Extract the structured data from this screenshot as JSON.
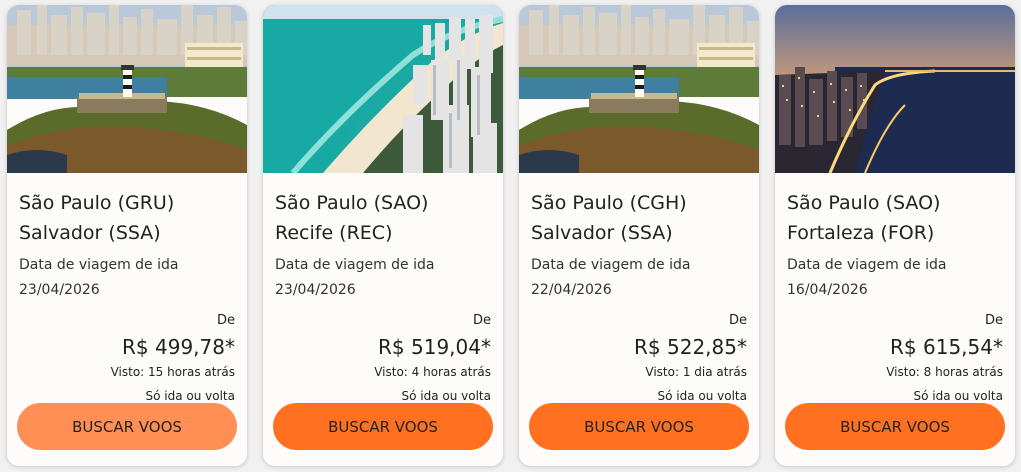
{
  "accent_color": "#ff7120",
  "accent_color_light": "#ff8f55",
  "cards": [
    {
      "origin": "São Paulo (GRU)",
      "destination": "Salvador (SSA)",
      "date_label": "Data de viagem de ida",
      "date": "23/04/2026",
      "price_prefix": "De",
      "price": "R$ 499,78*",
      "seen": "Visto: 15 horas atrás",
      "trip_type": "Só ida ou volta",
      "button_label": "BUSCAR VOOS",
      "image": "salvador-lighthouse-photo"
    },
    {
      "origin": "São Paulo (SAO)",
      "destination": "Recife (REC)",
      "date_label": "Data de viagem de ida",
      "date": "23/04/2026",
      "price_prefix": "De",
      "price": "R$ 519,04*",
      "seen": "Visto: 4 horas atrás",
      "trip_type": "Só ida ou volta",
      "button_label": "BUSCAR VOOS",
      "image": "recife-beach-photo"
    },
    {
      "origin": "São Paulo (CGH)",
      "destination": "Salvador (SSA)",
      "date_label": "Data de viagem de ida",
      "date": "22/04/2026",
      "price_prefix": "De",
      "price": "R$ 522,85*",
      "seen": "Visto: 1 dia atrás",
      "trip_type": "Só ida ou volta",
      "button_label": "BUSCAR VOOS",
      "image": "salvador-lighthouse-photo"
    },
    {
      "origin": "São Paulo (SAO)",
      "destination": "Fortaleza (FOR)",
      "date_label": "Data de viagem de ida",
      "date": "16/04/2026",
      "price_prefix": "De",
      "price": "R$ 615,54*",
      "seen": "Visto: 8 horas atrás",
      "trip_type": "Só ida ou volta",
      "button_label": "BUSCAR VOOS",
      "image": "fortaleza-night-photo"
    }
  ]
}
